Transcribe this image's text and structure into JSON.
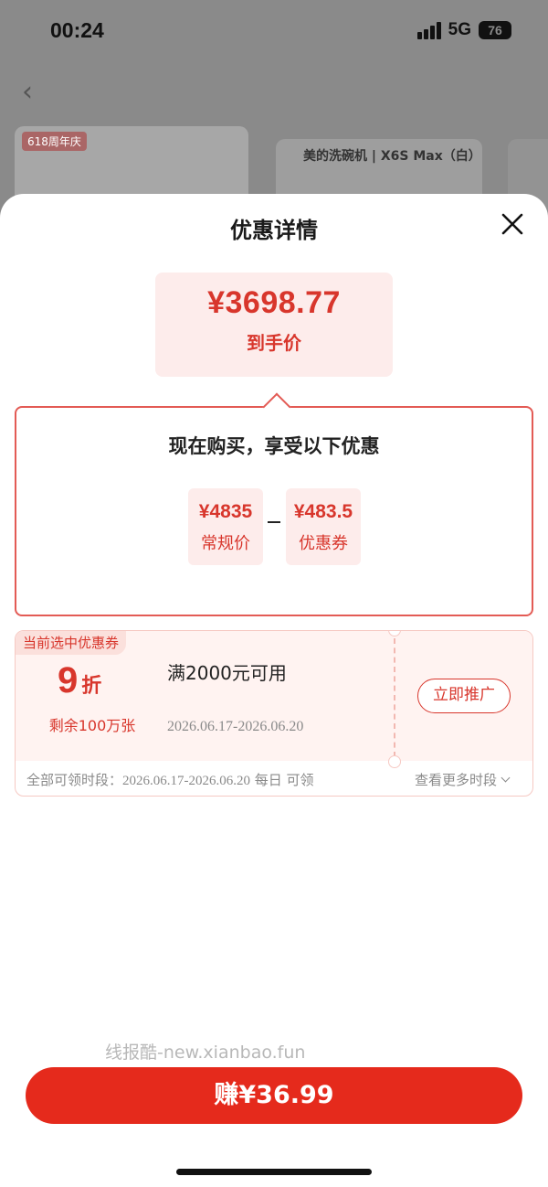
{
  "status_bar": {
    "time": "00:24",
    "network": "5G",
    "battery": "76"
  },
  "background": {
    "thumb1_tag": "618周年庆",
    "thumb2_title": "美的洗碗机 | X6S Max（白）"
  },
  "sheet": {
    "title": "优惠详情",
    "final_price": "¥3698.77",
    "final_price_label": "到手价",
    "offer_heading": "现在购买，享受以下优惠",
    "regular_price": "¥4835",
    "regular_price_label": "常规价",
    "coupon_value": "¥483.5",
    "coupon_value_label": "优惠券"
  },
  "coupon": {
    "tag": "当前选中优惠券",
    "discount_number": "9",
    "discount_unit": "折",
    "remaining": "剩余100万张",
    "condition": "满2000元可用",
    "valid_range": "2026.06.17-2026.06.20",
    "promote_label": "立即推广",
    "footer_prefix": "全部可领时段：",
    "footer_dates": "2026.06.17-2026.06.20",
    "footer_suffix": " 每日 可领",
    "more_label": "查看更多时段"
  },
  "watermark": "线报酷-new.xianbao.fun",
  "earn_button": "赚¥36.99",
  "colors": {
    "accent": "#d8362c",
    "button": "#e52a1c",
    "chip_bg": "#fdeceb"
  }
}
